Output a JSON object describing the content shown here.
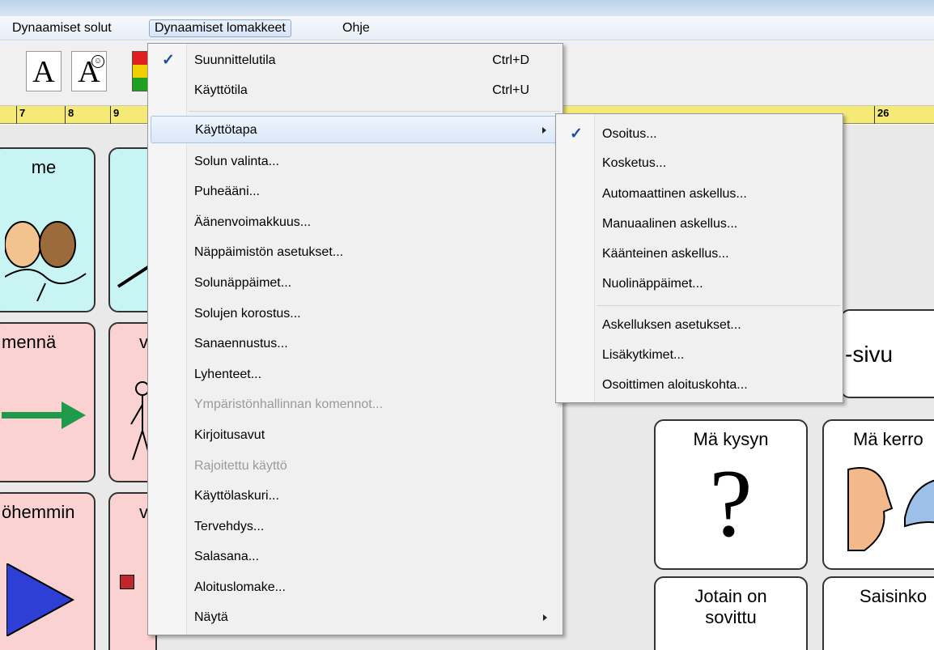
{
  "menubar": {
    "items": [
      {
        "label": "Dynaamiset solut"
      },
      {
        "label": "Dynaamiset lomakkeet"
      },
      {
        "label": "Ohje"
      }
    ]
  },
  "ruler": {
    "ticks": [
      "7",
      "8",
      "9",
      "26"
    ]
  },
  "cells": {
    "me": "me",
    "menna": "mennä",
    "ohemmin": "öhemmin",
    "v1": "v",
    "v2": "v",
    "sivu": "-sivu",
    "kysyn": "Mä kysyn",
    "kerro": "Mä kerro",
    "jotain": "Jotain on sovittu",
    "saisinko": "Saisinko",
    "question": "?"
  },
  "main_menu": {
    "items": [
      {
        "label": "Suunnittelutila",
        "shortcut": "Ctrl+D",
        "checked": true
      },
      {
        "label": "Käyttötila",
        "shortcut": "Ctrl+U"
      },
      {
        "label": "Käyttötapa",
        "submenu": true,
        "highlighted": true
      },
      {
        "label": "Solun valinta..."
      },
      {
        "label": "Puheääni..."
      },
      {
        "label": "Äänenvoimakkuus..."
      },
      {
        "label": "Näppäimistön asetukset..."
      },
      {
        "label": "Solunäppäimet..."
      },
      {
        "label": "Solujen korostus..."
      },
      {
        "label": "Sanaennustus..."
      },
      {
        "label": "Lyhenteet..."
      },
      {
        "label": "Ympäristönhallinnan komennot...",
        "disabled": true
      },
      {
        "label": "Kirjoitusavut"
      },
      {
        "label": "Rajoitettu käyttö",
        "disabled": true
      },
      {
        "label": "Käyttölaskuri..."
      },
      {
        "label": "Tervehdys..."
      },
      {
        "label": "Salasana..."
      },
      {
        "label": "Aloituslomake..."
      },
      {
        "label": "Näytä",
        "submenu": true
      }
    ]
  },
  "sub_menu": {
    "items": [
      {
        "label": "Osoitus...",
        "checked": true
      },
      {
        "label": "Kosketus..."
      },
      {
        "label": "Automaattinen askellus..."
      },
      {
        "label": "Manuaalinen askellus..."
      },
      {
        "label": "Käänteinen askellus..."
      },
      {
        "label": "Nuolinäppäimet..."
      },
      {
        "label": "Askelluksen asetukset..."
      },
      {
        "label": "Lisäkytkimet..."
      },
      {
        "label": "Osoittimen aloituskohta..."
      }
    ]
  },
  "glyphs": {
    "check": "✓"
  },
  "colors": {
    "ruler": "#f6ea76",
    "cyan_cell": "#c9f4f4",
    "pink_cell": "#fad2d2",
    "accent": "#1b4f9c"
  }
}
